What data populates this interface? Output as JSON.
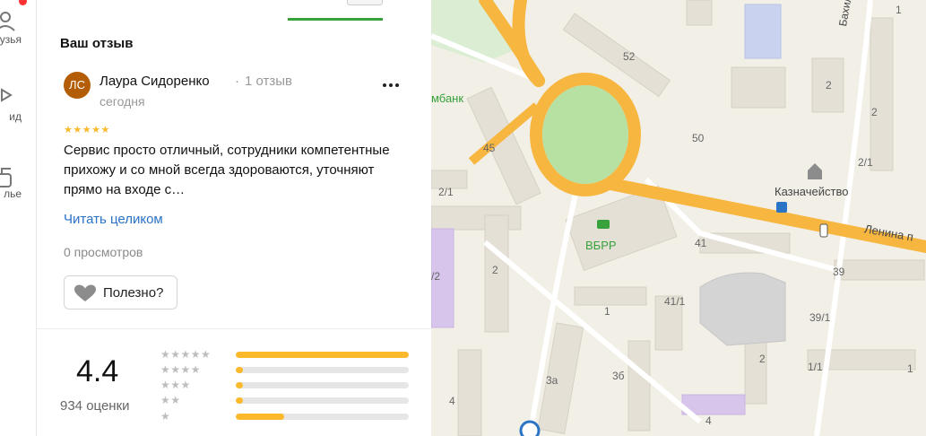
{
  "rail": {
    "items": [
      {
        "label": "узья",
        "icon": "friends-icon"
      },
      {
        "label": "ид",
        "icon": "guide-icon"
      },
      {
        "label": "лье",
        "icon": "gallery-icon"
      }
    ]
  },
  "review": {
    "section_title": "Ваш отзыв",
    "author": {
      "initials": "ЛС",
      "name": "Лаура Сидоренко",
      "separator": "·",
      "review_count": "1 отзыв",
      "date": "сегодня",
      "avatar_color": "#b35d06"
    },
    "rating_stars": "★★★★★",
    "rating": 5,
    "text": "Сервис просто отличный, сотрудники компетентные прихожу и со мной всегда здороваются, уточняют прямо на входе с…",
    "read_more": "Читать целиком",
    "views": "0 просмотров",
    "useful_label": "Полезно?"
  },
  "summary": {
    "rating": "4.4",
    "count": "934 оценки",
    "distribution": [
      {
        "stars": "★★★★★",
        "fraction": 1.0
      },
      {
        "stars": "★★★★",
        "fraction": 0.04
      },
      {
        "stars": "★★★",
        "fraction": 0.04
      },
      {
        "stars": "★★",
        "fraction": 0.04
      },
      {
        "stars": "★",
        "fraction": 0.28
      }
    ],
    "accent_color": "#fcb92c"
  },
  "map": {
    "street_labels": {
      "bakhilova": "Бахилова",
      "lenina": "Ленина п"
    },
    "house_numbers": {
      "n52": "52",
      "n45": "45",
      "n50": "50",
      "n2_1": "2/1",
      "n2a": "2",
      "n2b": "2",
      "n2c": "2",
      "n1a": "1",
      "n1b": "1",
      "n21": "2/1",
      "n41": "41",
      "n41_1": "41/1",
      "n39": "39",
      "n39_1": "39/1",
      "n1_1": "1/1",
      "n3a": "3а",
      "n3b": "3б",
      "n4a": "4",
      "n4b": "4",
      "n2d": "2",
      "n2_2": "/2",
      "n1c": "1"
    },
    "pois": {
      "bank": "мбанк",
      "vbrr": "ВБРР",
      "treasury": "Казначейство"
    }
  }
}
